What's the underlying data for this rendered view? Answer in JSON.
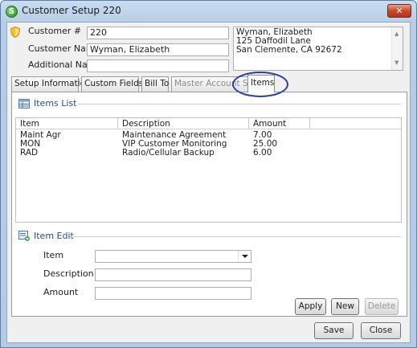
{
  "window": {
    "title": "Customer Setup 220",
    "close_label": "✕"
  },
  "customer": {
    "number_label": "Customer #",
    "number_value": "220",
    "name_label": "Customer Name",
    "name_value": "Wyman, Elizabeth",
    "additional_label": "Additional Name",
    "additional_value": "",
    "address_lines": [
      "Wyman, Elizabeth",
      "125 Daffodil Lane",
      "San Clemente, CA  92672"
    ]
  },
  "tabs": [
    {
      "label": "Setup Information",
      "active": false,
      "enabled": true
    },
    {
      "label": "Custom Fields",
      "active": false,
      "enabled": true
    },
    {
      "label": "Bill To",
      "active": false,
      "enabled": true
    },
    {
      "label": "Master Account Setup",
      "active": false,
      "enabled": false
    },
    {
      "label": "Items",
      "active": true,
      "enabled": true
    }
  ],
  "items_list": {
    "header": "Items List",
    "columns": [
      "Item",
      "Description",
      "Amount"
    ],
    "rows": [
      [
        "Maint Agr",
        "Maintenance Agreement",
        "7.00"
      ],
      [
        "MON",
        "VIP Customer Monitoring",
        "25.00"
      ],
      [
        "RAD",
        "Radio/Cellular Backup",
        "6.00"
      ]
    ]
  },
  "item_edit": {
    "header": "Item Edit",
    "item_label": "Item",
    "item_value": "",
    "description_label": "Description",
    "description_value": "",
    "amount_label": "Amount",
    "amount_value": ""
  },
  "buttons": {
    "apply": "Apply",
    "new": "New",
    "delete": "Delete",
    "save": "Save",
    "close": "Close"
  },
  "colors": {
    "accent": "#1f4e96",
    "highlight_ring": "#2a3f9c",
    "title_close": "#c9482a"
  },
  "icons": {
    "app": "app-logo-icon",
    "customer": "shield-icon",
    "items_list": "grid-list-icon",
    "item_edit": "edit-form-icon"
  }
}
